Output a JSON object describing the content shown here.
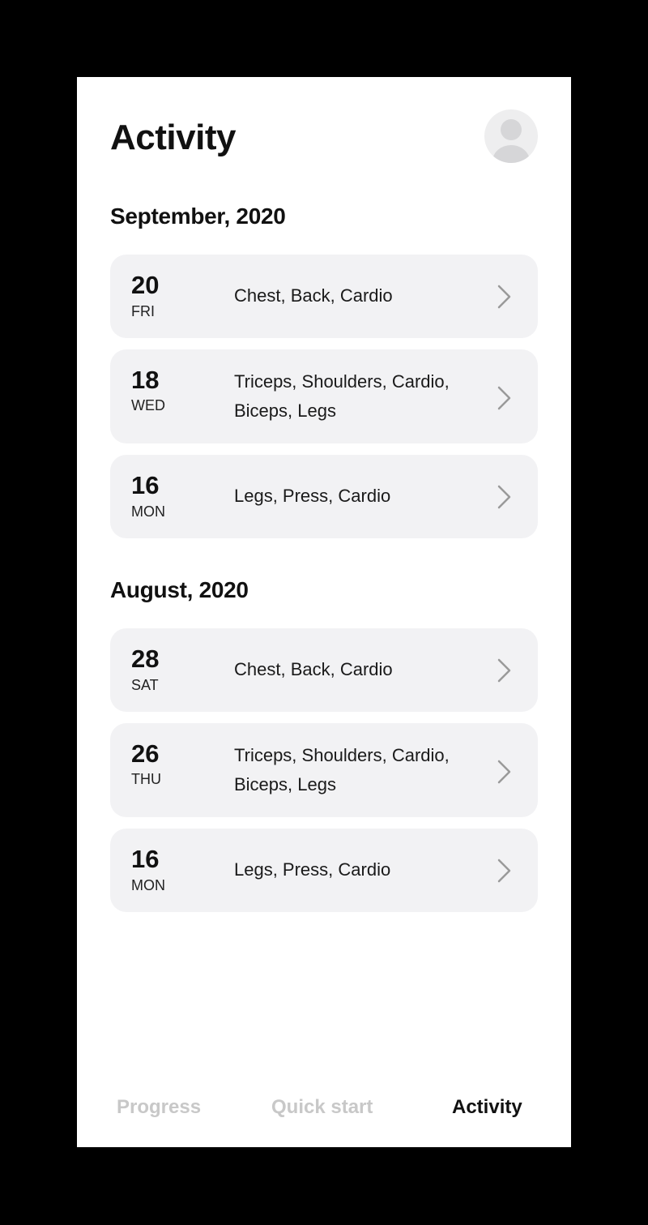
{
  "header": {
    "title": "Activity",
    "avatar_icon": "user-avatar-icon"
  },
  "sections": [
    {
      "title": "September, 2020",
      "items": [
        {
          "day": "20",
          "weekday": "FRI",
          "muscles": "Chest, Back, Cardio"
        },
        {
          "day": "18",
          "weekday": "WED",
          "muscles": "Triceps, Shoulders, Cardio, Biceps, Legs"
        },
        {
          "day": "16",
          "weekday": "MON",
          "muscles": "Legs, Press, Cardio"
        }
      ]
    },
    {
      "title": "August, 2020",
      "items": [
        {
          "day": "28",
          "weekday": "SAT",
          "muscles": "Chest, Back, Cardio"
        },
        {
          "day": "26",
          "weekday": "THU",
          "muscles": "Triceps, Shoulders, Cardio, Biceps, Legs"
        },
        {
          "day": "16",
          "weekday": "MON",
          "muscles": "Legs, Press, Cardio"
        }
      ]
    }
  ],
  "tabs": {
    "progress": "Progress",
    "quick_start": "Quick start",
    "activity": "Activity",
    "active": "activity"
  },
  "colors": {
    "page_background": "#ffffff",
    "card_background": "#f2f2f4",
    "text_primary": "#111111",
    "tab_inactive": "#c8c8c8",
    "chevron": "#9a9a9a"
  }
}
